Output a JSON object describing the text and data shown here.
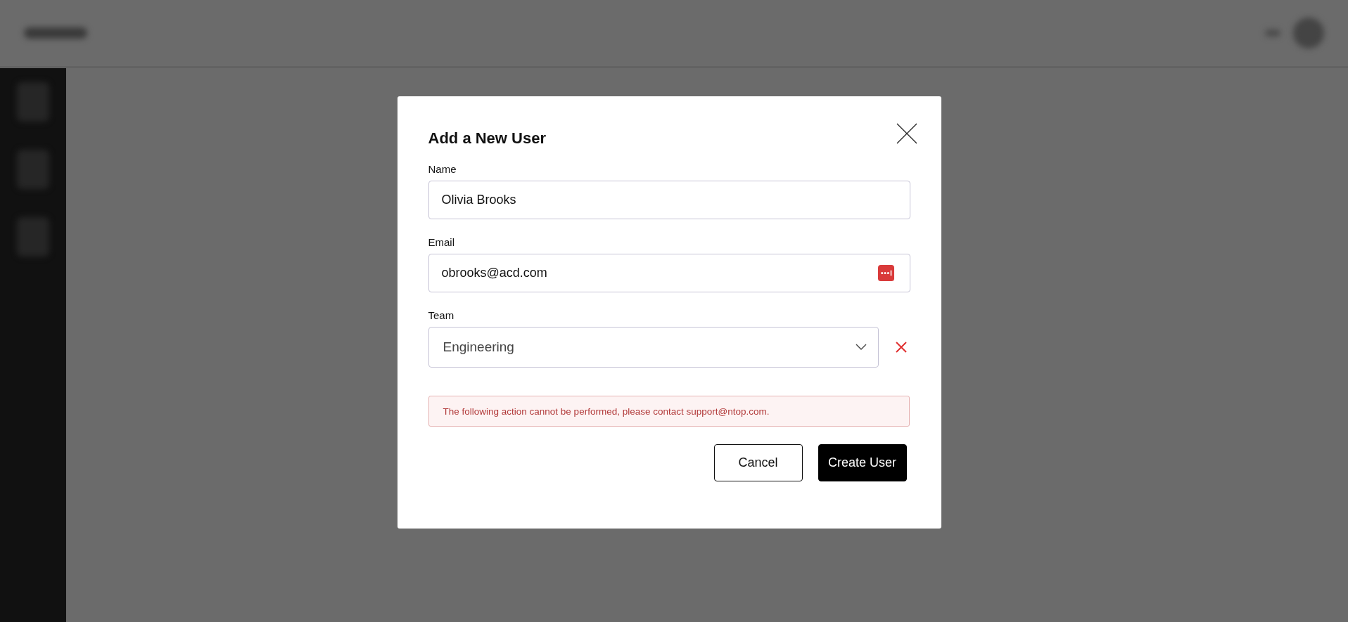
{
  "dialog": {
    "title": "Add a New User",
    "fields": [
      {
        "kind": "text",
        "label": "Name",
        "value": "Olivia Brooks"
      },
      {
        "kind": "email",
        "label": "Email",
        "value": "obrooks@acd.com"
      },
      {
        "kind": "select",
        "label": "Team",
        "value": "Engineering"
      }
    ],
    "error": "The following action cannot be performed, please contact support@ntop.com.",
    "buttons": [
      {
        "kind": "secondary",
        "label": "Cancel"
      },
      {
        "kind": "primary",
        "label": "Create User"
      }
    ]
  }
}
